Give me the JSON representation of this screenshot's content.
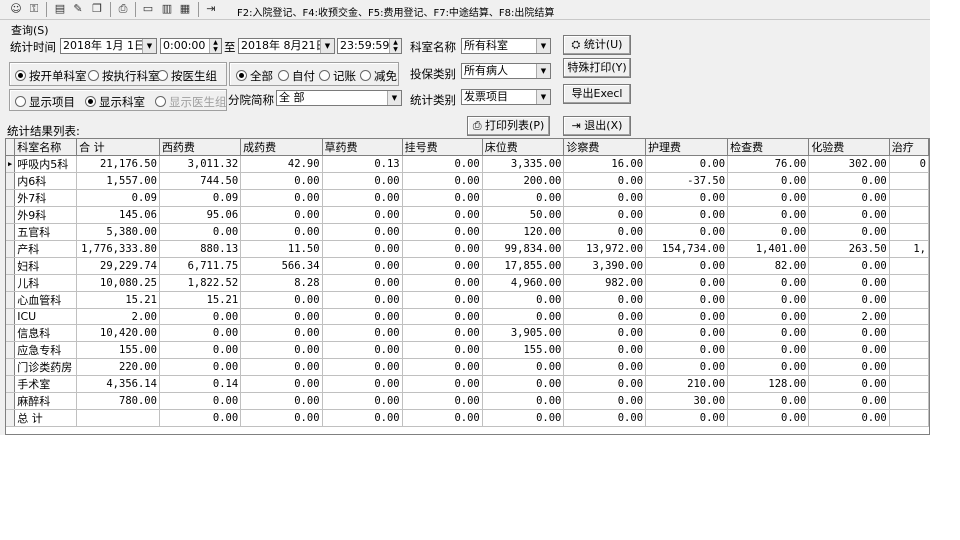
{
  "toolbar": {
    "icons": [
      "users-icon",
      "key-icon",
      "document-icon",
      "edit-icon",
      "copy-icon",
      "printer-icon",
      "card-icon",
      "report-icon",
      "chart-icon",
      "exit-icon"
    ],
    "shortcuts": "F2:入院登记、F4:收预交金、F5:费用登记、F7:中途结算、F8:出院结算"
  },
  "query": {
    "group_label": "查询(S)",
    "stat_time_label": "统计时间",
    "start_date": "2018年 1月 1日",
    "start_time": "0:00:00",
    "to_label": "至",
    "end_date": "2018年 8月21日",
    "end_time": "23:59:59",
    "dept_name_label": "科室名称",
    "dept_name_value": "所有科室",
    "insurance_label": "投保类别",
    "insurance_value": "所有病人",
    "stat_type_label": "统计类别",
    "stat_type_value": "发票项目",
    "branch_label": "分院简称",
    "branch_value": "全 部",
    "stat_button": "统计(U)",
    "special_print_button": "特殊打印(Y)",
    "export_button": "导出Execl",
    "radio_open_dept": "按开单科室",
    "radio_exec_dept": "按执行科室",
    "radio_doctor_group": "按医生组",
    "radio_all": "全部",
    "radio_self": "自付",
    "radio_account": "记账",
    "radio_waive": "减免",
    "radio_show_items": "显示项目",
    "radio_show_dept": "显示科室",
    "radio_show_doctor_group": "显示医生组"
  },
  "result": {
    "list_label": "统计结果列表:",
    "print_button": "打印列表(P)",
    "exit_button": "退出(X)",
    "columns": [
      "科室名称",
      "合 计",
      "西药费",
      "成药费",
      "草药费",
      "挂号费",
      "床位费",
      "诊察费",
      "护理费",
      "检查费",
      "化验费",
      "治疗"
    ],
    "rows": [
      [
        "呼吸内5科",
        "21,176.50",
        "3,011.32",
        "42.90",
        "0.13",
        "0.00",
        "3,335.00",
        "16.00",
        "0.00",
        "76.00",
        "302.00",
        "0"
      ],
      [
        "内6科",
        "1,557.00",
        "744.50",
        "0.00",
        "0.00",
        "0.00",
        "200.00",
        "0.00",
        "-37.50",
        "0.00",
        "0.00",
        ""
      ],
      [
        "外7科",
        "0.09",
        "0.09",
        "0.00",
        "0.00",
        "0.00",
        "0.00",
        "0.00",
        "0.00",
        "0.00",
        "0.00",
        ""
      ],
      [
        "外9科",
        "145.06",
        "95.06",
        "0.00",
        "0.00",
        "0.00",
        "50.00",
        "0.00",
        "0.00",
        "0.00",
        "0.00",
        ""
      ],
      [
        "五官科",
        "5,380.00",
        "0.00",
        "0.00",
        "0.00",
        "0.00",
        "120.00",
        "0.00",
        "0.00",
        "0.00",
        "0.00",
        ""
      ],
      [
        "产科",
        "1,776,333.80",
        "880.13",
        "11.50",
        "0.00",
        "0.00",
        "99,834.00",
        "13,972.00",
        "154,734.00",
        "1,401.00",
        "263.50",
        "1,"
      ],
      [
        "妇科",
        "29,229.74",
        "6,711.75",
        "566.34",
        "0.00",
        "0.00",
        "17,855.00",
        "3,390.00",
        "0.00",
        "82.00",
        "0.00",
        ""
      ],
      [
        "儿科",
        "10,080.25",
        "1,822.52",
        "8.28",
        "0.00",
        "0.00",
        "4,960.00",
        "982.00",
        "0.00",
        "0.00",
        "0.00",
        ""
      ],
      [
        "心血管科",
        "15.21",
        "15.21",
        "0.00",
        "0.00",
        "0.00",
        "0.00",
        "0.00",
        "0.00",
        "0.00",
        "0.00",
        ""
      ],
      [
        "ICU",
        "2.00",
        "0.00",
        "0.00",
        "0.00",
        "0.00",
        "0.00",
        "0.00",
        "0.00",
        "0.00",
        "2.00",
        ""
      ],
      [
        "信息科",
        "10,420.00",
        "0.00",
        "0.00",
        "0.00",
        "0.00",
        "3,905.00",
        "0.00",
        "0.00",
        "0.00",
        "0.00",
        ""
      ],
      [
        "应急专科",
        "155.00",
        "0.00",
        "0.00",
        "0.00",
        "0.00",
        "155.00",
        "0.00",
        "0.00",
        "0.00",
        "0.00",
        ""
      ],
      [
        "门诊类药房",
        "220.00",
        "0.00",
        "0.00",
        "0.00",
        "0.00",
        "0.00",
        "0.00",
        "0.00",
        "0.00",
        "0.00",
        ""
      ],
      [
        "手术室",
        "4,356.14",
        "0.14",
        "0.00",
        "0.00",
        "0.00",
        "0.00",
        "0.00",
        "210.00",
        "128.00",
        "0.00",
        ""
      ],
      [
        "麻醉科",
        "780.00",
        "0.00",
        "0.00",
        "0.00",
        "0.00",
        "0.00",
        "0.00",
        "30.00",
        "0.00",
        "0.00",
        ""
      ],
      [
        "总 计",
        "",
        "0.00",
        "0.00",
        "0.00",
        "0.00",
        "0.00",
        "0.00",
        "0.00",
        "0.00",
        "0.00",
        ""
      ]
    ]
  }
}
